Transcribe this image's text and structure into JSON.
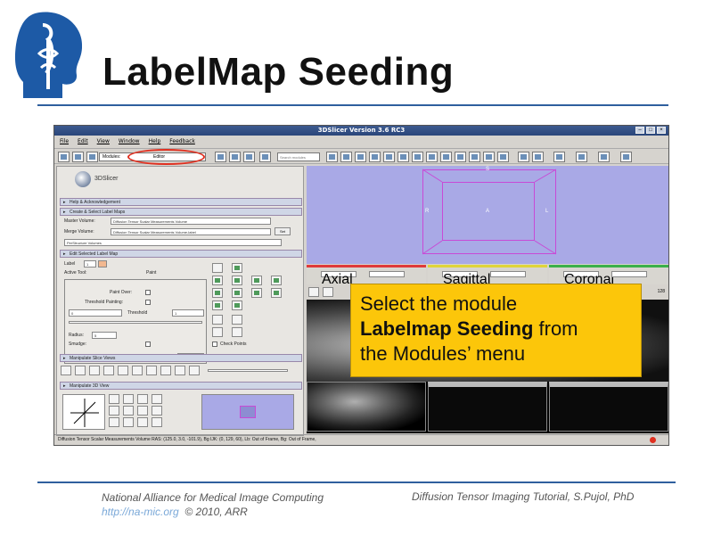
{
  "slide": {
    "title": "LabelMap Seeding",
    "footer_org": "National Alliance for Medical Image Computing",
    "footer_link": "http://na-mic.org",
    "footer_copyright": "© 2010, ARR",
    "footer_right": "Diffusion Tensor Imaging Tutorial, S.Pujol, PhD"
  },
  "callout": {
    "line1": "Select the module",
    "bold": "Labelmap Seeding",
    "after_bold": " from",
    "line3": "the Modules’ menu"
  },
  "window": {
    "title": "3DSlicer Version 3.6 RC3",
    "menus": [
      "File",
      "Edit",
      "View",
      "Window",
      "Help",
      "Feedback"
    ],
    "modules_label": "Modules:",
    "modules_value": "Editor",
    "search_placeholder": "Search modules"
  },
  "left_panel": {
    "logo_text": "3DSlicer",
    "sections": {
      "help": "Help & Acknowledgement",
      "create": "Create & Select Label Maps",
      "edit": "Edit Selected Label Map",
      "manipulate_slice": "Manipulate Slice Views",
      "manipulate_3d": "Manipulate 3D View"
    },
    "master_volume_label": "Master Volume:",
    "master_volume_value": "Diffusion Tensor Scalar Measurements Volume",
    "merge_volume_label": "Merge Volume:",
    "merge_volume_value": "Diffusion Tensor Scalar Measurements Volume-label",
    "set_button": "Set",
    "structures_label": "PerStructure Volumes",
    "label_label": "Label",
    "label_value": "1",
    "active_tool_label": "Active Tool:",
    "active_tool_value": "Paint",
    "paint_over_label": "Paint Over:",
    "threshold_painting_label": "Threshold Painting:",
    "threshold_label": "Threshold",
    "threshold_min": "0",
    "threshold_max": "1",
    "radius_label": "Radius:",
    "radius_value": "5",
    "smudge_label": "Smudge:",
    "cancel_button": "Cancel",
    "check_points_label": "Check Points"
  },
  "status_bar": {
    "text": "Diffusion Tensor Scalar Measurements Volume RAS: (125.0, 3.0, -101.9), Bg IJK: (0, 129, 60), Lb: Out of Frame, Bg: Out of Frame,"
  },
  "viewer": {
    "axis_s": "S",
    "axis_r": "R",
    "axis_a": "A",
    "axis_l": "L",
    "slice_controls": [
      {
        "orientation": "Axial",
        "color": "#e03a3a"
      },
      {
        "orientation": "Sagittal",
        "color": "#e0d43a"
      },
      {
        "orientation": "Coronal",
        "color": "#3ab04a"
      }
    ],
    "zoom": "128"
  }
}
